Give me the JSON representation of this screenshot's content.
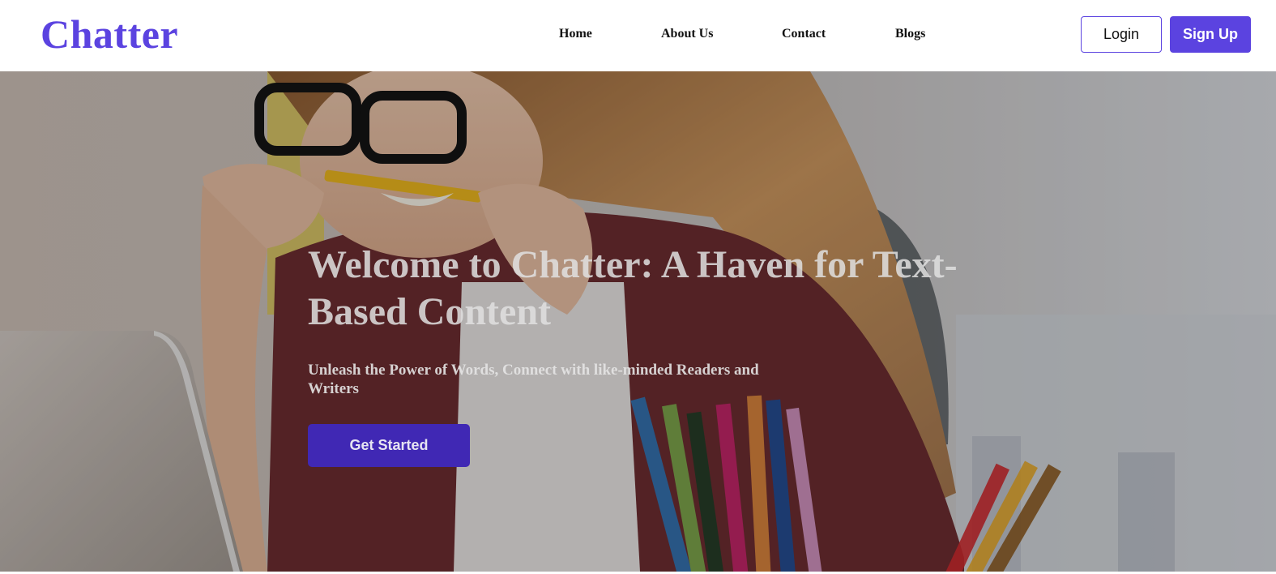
{
  "header": {
    "logo": "Chatter",
    "nav": {
      "home": "Home",
      "about": "About Us",
      "contact": "Contact",
      "blogs": "Blogs"
    },
    "login_label": "Login",
    "signup_label": "Sign Up"
  },
  "hero": {
    "title": "Welcome to Chatter: A Haven for Text-Based Content",
    "subtitle": "Unleash the Power of Words, Connect with like-minded Readers and Writers",
    "cta_label": "Get Started",
    "background_image": "hero-photo-woman-biting-pencil"
  },
  "colors": {
    "brand": "#5b43e0",
    "cta": "#4028b4",
    "header_bg": "#ffffff",
    "nav_text": "#111111"
  }
}
